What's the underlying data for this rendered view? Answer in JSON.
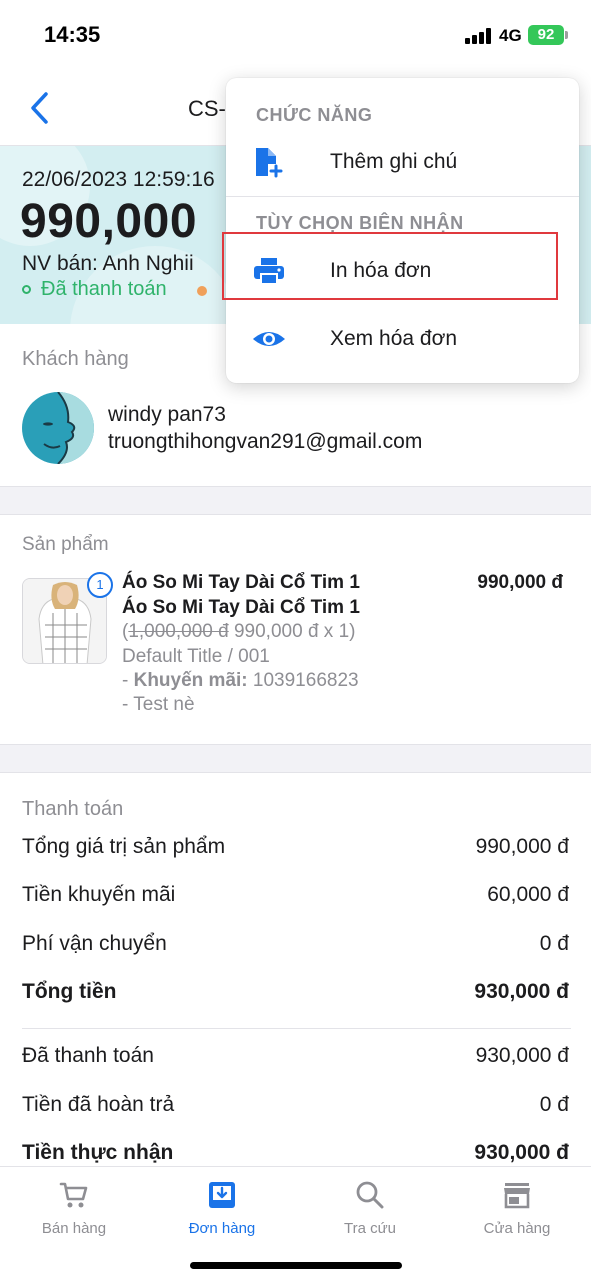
{
  "status_bar": {
    "time": "14:35",
    "network": "4G",
    "battery": "92"
  },
  "nav": {
    "title": "CS-"
  },
  "summary": {
    "date": "22/06/2023 12:59:16",
    "amount": "990,000",
    "seller": "NV bán: Anh Nghii",
    "payment_status": "Đã thanh toán"
  },
  "customer": {
    "section_label": "Khách hàng",
    "name": "windy pan73",
    "email": "truongthihongvan291@gmail.com"
  },
  "product": {
    "section_label": "Sản phẩm",
    "quantity_badge": "1",
    "name_line1": "Áo So Mi Tay Dài Cổ Tim 1",
    "name_line2": "Áo So Mi Tay Dài Cổ Tim 1",
    "price_open": "(",
    "original_price": "1,000,000 đ",
    "price_detail": " 990,000 đ x 1)",
    "variant": "Default Title / 001",
    "promo_prefix": "- ",
    "promo_label": "Khuyến mãi:",
    "promo_code": " 1039166823",
    "note": "- Test nè",
    "line_total": "990,000 đ"
  },
  "payment": {
    "section_label": "Thanh toán",
    "rows": [
      {
        "label": "Tổng giá trị sản phẩm",
        "value": "990,000 đ"
      },
      {
        "label": "Tiền khuyến mãi",
        "value": "60,000 đ"
      },
      {
        "label": "Phí vận chuyển",
        "value": "0 đ"
      },
      {
        "label": "Tổng tiền",
        "value": "930,000 đ"
      },
      {
        "label": "Đã thanh toán",
        "value": "930,000 đ"
      },
      {
        "label": "Tiền đã hoàn trả",
        "value": "0 đ"
      },
      {
        "label": "Tiền thực nhận",
        "value": "930,000 đ"
      }
    ]
  },
  "menu": {
    "header_functions": "CHỨC NĂNG",
    "add_note": "Thêm ghi chú",
    "header_receipt": "TÙY CHỌN BIÊN NHẬN",
    "print_invoice": "In hóa đơn",
    "view_invoice": "Xem hóa đơn"
  },
  "tabs": [
    {
      "label": "Bán hàng",
      "icon": "cart-icon"
    },
    {
      "label": "Đơn hàng",
      "icon": "orders-icon",
      "active": true
    },
    {
      "label": "Tra cứu",
      "icon": "search-icon"
    },
    {
      "label": "Cửa hàng",
      "icon": "store-icon"
    }
  ],
  "colors": {
    "accent": "#1a73e8",
    "paid": "#2fb36b",
    "banner": "#d3eef1",
    "highlight": "#e0393e"
  }
}
